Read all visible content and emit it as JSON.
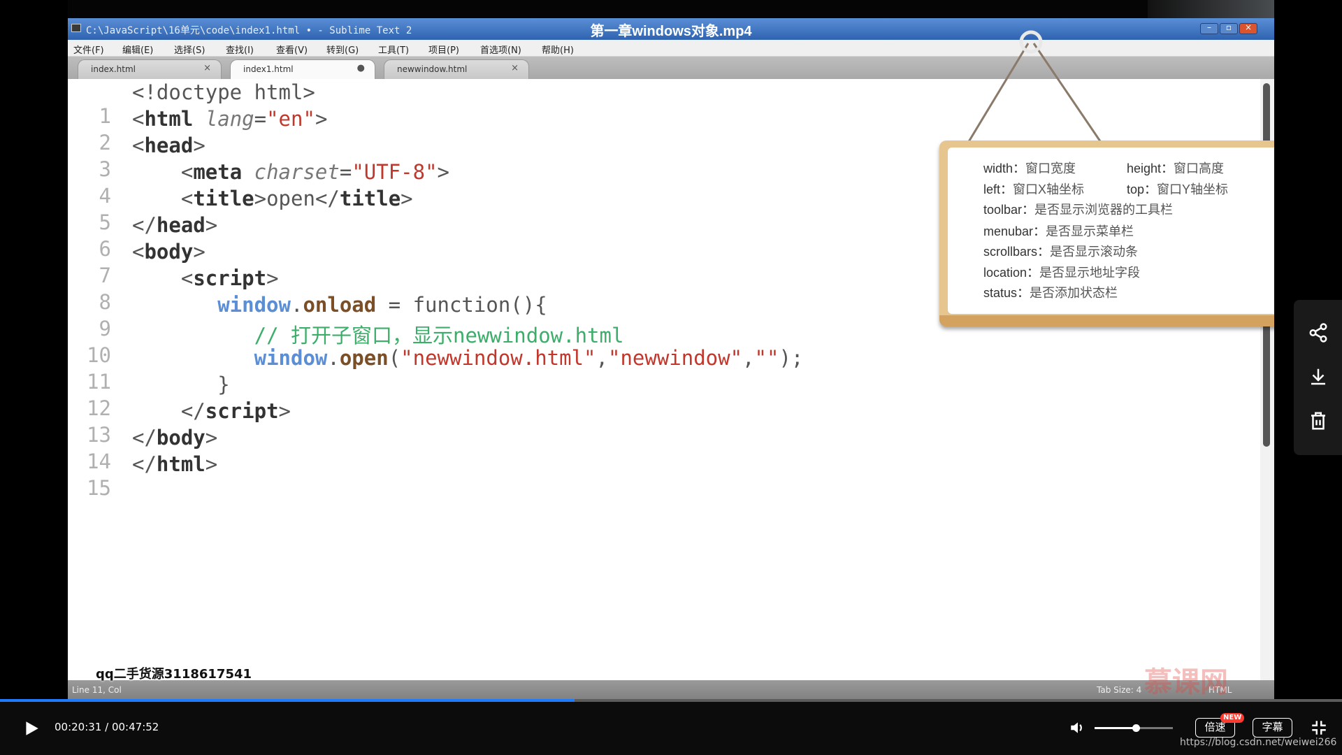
{
  "video": {
    "title": "第一章windows对象.mp4"
  },
  "sublime": {
    "title": "C:\\JavaScript\\16单元\\code\\index1.html • - Sublime Text 2",
    "menu": [
      "文件(F)",
      "编辑(E)",
      "选择(S)",
      "查找(I)",
      "查看(V)",
      "转到(G)",
      "工具(T)",
      "项目(P)",
      "首选项(N)",
      "帮助(H)"
    ],
    "tabs": [
      {
        "label": "index.html",
        "close": "×"
      },
      {
        "label": "index1.html",
        "close": "●"
      },
      {
        "label": "newwindow.html",
        "close": "×"
      }
    ],
    "line_numbers": [
      "1",
      "2",
      "3",
      "4",
      "5",
      "6",
      "7",
      "8",
      "9",
      "10",
      "11",
      "12",
      "13",
      "14",
      "15"
    ],
    "code": {
      "l1": "<!doctype html>",
      "l2_open": "<",
      "l2_tag": "html",
      "l2_attr": "lang",
      "l2_eq": "=",
      "l2_val": "\"en\"",
      "l2_close": ">",
      "l3_open": "<",
      "l3_tag": "head",
      "l3_close": ">",
      "l4_open": "<",
      "l4_tag": "meta",
      "l4_attr": "charset",
      "l4_eq": "=",
      "l4_val": "\"UTF-8\"",
      "l4_close": ">",
      "l5_open": "<",
      "l5_tag": "title",
      "l5_mid1": ">",
      "l5_text": "open",
      "l5_mid2": "</",
      "l5_tag2": "title",
      "l5_close": ">",
      "l6_open": "</",
      "l6_tag": "head",
      "l6_close": ">",
      "l7_open": "<",
      "l7_tag": "body",
      "l7_close": ">",
      "l8_open": "<",
      "l8_tag": "script",
      "l8_close": ">",
      "l9_win": "window",
      "l9_dot": ".",
      "l9_prop": "onload",
      "l9_rest": " = function(){",
      "l10": "// 打开子窗口，显示newwindow.html",
      "l11_win": "window",
      "l11_dot": ".",
      "l11_fn": "open",
      "l11_p1": "(",
      "l11_s1": "\"newwindow.html\"",
      "l11_c1": ",",
      "l11_s2": "\"newwindow\"",
      "l11_c2": ",",
      "l11_s3": "\"\"",
      "l11_p2": ");",
      "l12": "}",
      "l13_open": "</",
      "l13_tag": "script",
      "l13_close": ">",
      "l14_open": "</",
      "l14_tag": "body",
      "l14_close": ">",
      "l15_open": "</",
      "l15_tag": "html",
      "l15_close": ">"
    },
    "status": {
      "line": "Line 11, Col",
      "tab_size": "Tab Size: 4",
      "syntax": "HTML"
    }
  },
  "overlay_text": "qq二手货源3118617541",
  "watermark": "慕课网",
  "board": {
    "r1a_term": "width：",
    "r1a_desc": "窗口宽度",
    "r1b_term": "height：",
    "r1b_desc": "窗口高度",
    "r2a_term": "left：",
    "r2a_desc": "窗口X轴坐标",
    "r2b_term": "top：",
    "r2b_desc": "窗口Y轴坐标",
    "r3_term": "toolbar：",
    "r3_desc": "是否显示浏览器的工具栏",
    "r4_term": "menubar：",
    "r4_desc": "是否显示菜单栏",
    "r5_term": "scrollbars：",
    "r5_desc": "是否显示滚动条",
    "r6_term": "location：",
    "r6_desc": "是否显示地址字段",
    "r7_term": "status：",
    "r7_desc": "是否添加状态栏"
  },
  "player": {
    "current_time": "00:20:31",
    "duration": "00:47:52",
    "time_separator": " / ",
    "progress_fraction": 0.428,
    "volume_fraction": 0.53,
    "speed_label": "倍速",
    "new_badge": "NEW",
    "subtitle_label": "字幕",
    "source_url": "https://blog.csdn.net/weiwei266"
  },
  "icons": {
    "play": "play-icon",
    "volume": "volume-icon",
    "exit_fullscreen": "exit-fullscreen-icon",
    "share": "share-icon",
    "download": "download-icon",
    "delete": "trash-icon"
  },
  "colors": {
    "accent": "#1f7cff",
    "comment": "#3cae6a",
    "string": "#c2372b",
    "window": "#5b8ed5"
  }
}
